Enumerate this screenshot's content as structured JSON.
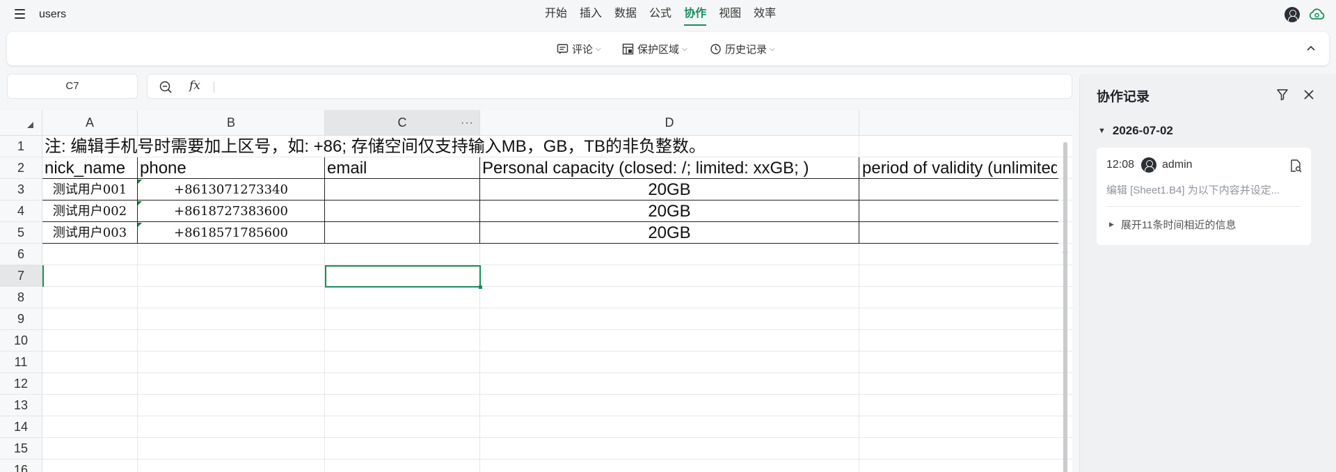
{
  "app": {
    "doc_title": "users"
  },
  "menu_tabs": [
    {
      "label": "开始"
    },
    {
      "label": "插入"
    },
    {
      "label": "数据"
    },
    {
      "label": "公式"
    },
    {
      "label": "协作",
      "active": true
    },
    {
      "label": "视图"
    },
    {
      "label": "效率"
    }
  ],
  "toolbar": {
    "comment_label": "评论",
    "protect_label": "保护区域",
    "history_label": "历史记录"
  },
  "formula_bar": {
    "cell_ref": "C7",
    "fx_label": "fx",
    "formula_value": ""
  },
  "grid": {
    "columns": [
      "A",
      "B",
      "C",
      "D"
    ],
    "selected_column": "C",
    "rows": [
      "1",
      "2",
      "3",
      "4",
      "5",
      "6",
      "7",
      "8",
      "9",
      "10",
      "11",
      "12",
      "13",
      "14",
      "15",
      "16"
    ],
    "selected_row": "7",
    "note": "注: 编辑手机号时需要加上区号，如: +86; 存储空间仅支持输入MB，GB，TB的非负整数。",
    "headers": {
      "nick_name": "nick_name",
      "phone": "phone",
      "email": "email",
      "capacity": "Personal capacity (closed: /; limited: xxGB; )",
      "validity": "period of validity (unlimited"
    },
    "data_rows": [
      {
        "nick_name": "测试用户001",
        "phone": "+8613071273340",
        "email": "",
        "capacity": "20GB"
      },
      {
        "nick_name": "测试用户002",
        "phone": "+8618727383600",
        "email": "",
        "capacity": "20GB"
      },
      {
        "nick_name": "测试用户003",
        "phone": "+8618571785600",
        "email": "",
        "capacity": "20GB"
      }
    ]
  },
  "panel": {
    "title": "协作记录",
    "date": "2026-07-02",
    "entry": {
      "time": "12:08",
      "user": "admin",
      "description": "编辑 [Sheet1.B4] 为以下内容并设定...",
      "expand_label": "展开11条时间相近的信息"
    }
  },
  "colors": {
    "accent": "#1b8c5a"
  }
}
